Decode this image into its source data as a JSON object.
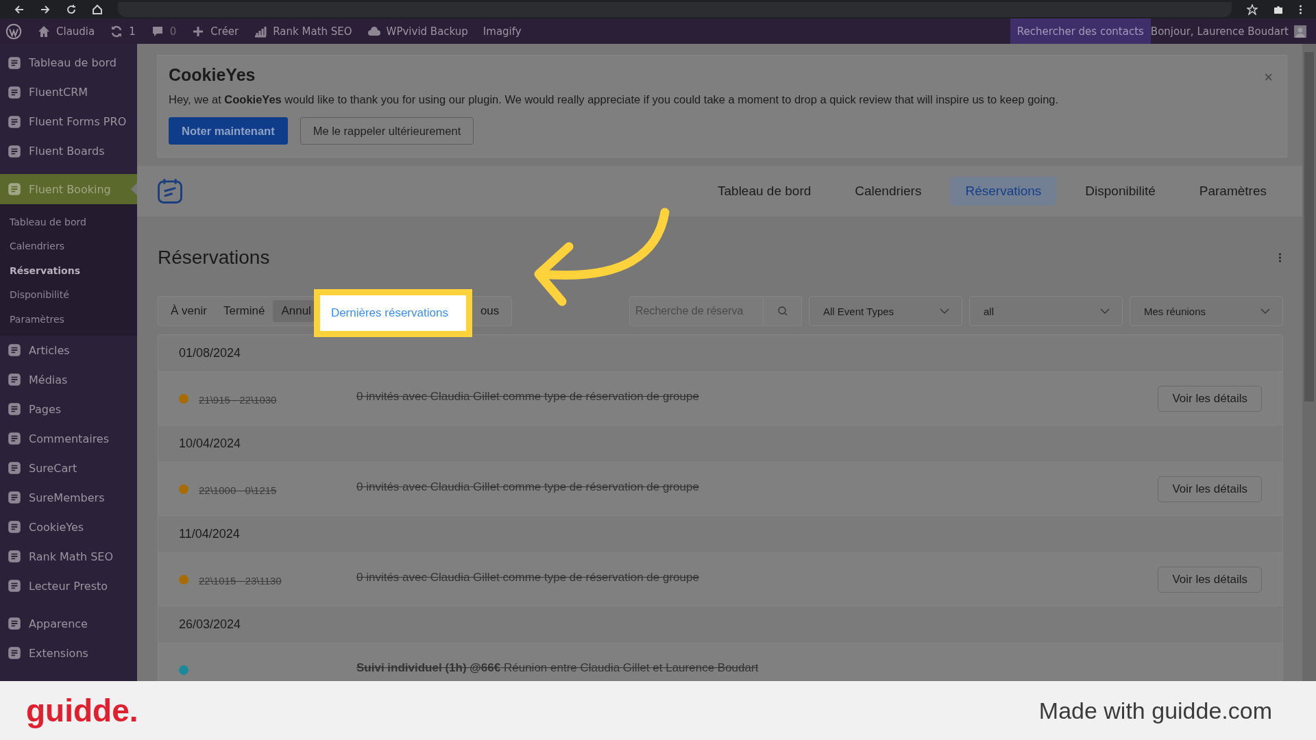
{
  "admin_bar": {
    "items": [
      {
        "kind": "logo"
      },
      {
        "kind": "home",
        "label": "Claudia"
      },
      {
        "kind": "update",
        "label": "1"
      },
      {
        "kind": "comment",
        "label": "0"
      },
      {
        "kind": "new",
        "label": "Créer"
      },
      {
        "kind": "chart",
        "label": "Rank Math SEO"
      },
      {
        "kind": "cloud",
        "label": "WPvivid Backup"
      },
      {
        "kind": "plain",
        "label": "Imagify"
      }
    ],
    "search": "Rechercher des contacts",
    "greeting": "Bonjour, Laurence Boudart"
  },
  "sidebar": {
    "items": [
      {
        "label": "Tableau de bord"
      },
      {
        "label": "FluentCRM"
      },
      {
        "label": "Fluent Forms PRO"
      },
      {
        "label": "Fluent Boards"
      },
      {
        "label": "Fluent Booking",
        "selected": true,
        "children": [
          {
            "label": "Tableau de bord",
            "selected": false
          },
          {
            "label": "Calendriers",
            "selected": false
          },
          {
            "label": "Réservations",
            "selected": true
          },
          {
            "label": "Disponibilité",
            "selected": false
          },
          {
            "label": "Paramètres",
            "selected": false
          }
        ]
      },
      {
        "label": "Articles"
      },
      {
        "label": "Médias"
      },
      {
        "label": "Pages"
      },
      {
        "label": "Commentaires"
      },
      {
        "label": "SureCart"
      },
      {
        "label": "SureMembers"
      },
      {
        "label": "CookieYes"
      },
      {
        "label": "Rank Math SEO"
      },
      {
        "label": "Lecteur Presto"
      },
      {
        "label": "Apparence",
        "gap": true
      },
      {
        "label": "Extensions"
      }
    ]
  },
  "notice": {
    "logo": "CookieYes",
    "message": "Hey, we at **CookieYes** would like to thank you for using our plugin. We would really appreciate if you could take a moment to drop a quick review that will inspire us to keep going.",
    "buttons": [
      {
        "label": "Noter maintenant",
        "kind": "primary"
      },
      {
        "label": "Me le rappeler ultérieurement",
        "kind": "secondary"
      }
    ],
    "close": "×"
  },
  "nav": {
    "tabs": [
      {
        "label": "Tableau de bord",
        "selected": false
      },
      {
        "label": "Calendriers",
        "selected": false
      },
      {
        "label": "Réservations",
        "selected": true
      },
      {
        "label": "Disponibilité",
        "selected": false
      },
      {
        "label": "Paramètres",
        "selected": false
      }
    ]
  },
  "title": "Réservations",
  "filters": {
    "tabs": [
      {
        "label": "À venir",
        "selected": false,
        "highlighted": false
      },
      {
        "label": "Terminé",
        "selected": false,
        "highlighted": false
      },
      {
        "label": "Annul",
        "selected": true,
        "highlighted": false
      },
      {
        "label": "Dernières réservations",
        "selected": false,
        "highlighted": true
      },
      {
        "label": "ous",
        "selected": false,
        "highlighted": false
      }
    ],
    "search_placeholder": "Recherche de réserva",
    "selects": [
      "All Event Types",
      "all",
      "Mes réunions"
    ]
  },
  "groups": [
    {
      "date": "01/08/2024",
      "items": [
        {
          "time": "21\\915 - 22\\1030",
          "color": "#a86c00",
          "cancelled": true,
          "text": "0 invités avec Claudia Gillet comme type de réservation de groupe",
          "button": "Voir les détails"
        }
      ]
    },
    {
      "date": "10/04/2024",
      "items": [
        {
          "time": "22\\1000 - 0\\1215",
          "color": "#a86c00",
          "cancelled": true,
          "text": "0 invités avec Claudia Gillet comme type de réservation de groupe",
          "button": "Voir les détails"
        }
      ]
    },
    {
      "date": "11/04/2024",
      "items": [
        {
          "time": "22\\1015 - 23\\1130",
          "color": "#a86c00",
          "cancelled": true,
          "text": "0 invités avec Claudia Gillet comme type de réservation de groupe",
          "button": "Voir les détails"
        }
      ]
    },
    {
      "date": "26/03/2024",
      "items": [
        {
          "color": "#1a8a9a",
          "cancelled": true,
          "text": "**Suivi individuel (1h) @66€** Réunion entre Claudia Gillet et Laurence Boudart"
        }
      ]
    }
  ],
  "footer": {
    "brand": "guidde.",
    "tagline": "Made with guidde.com"
  }
}
